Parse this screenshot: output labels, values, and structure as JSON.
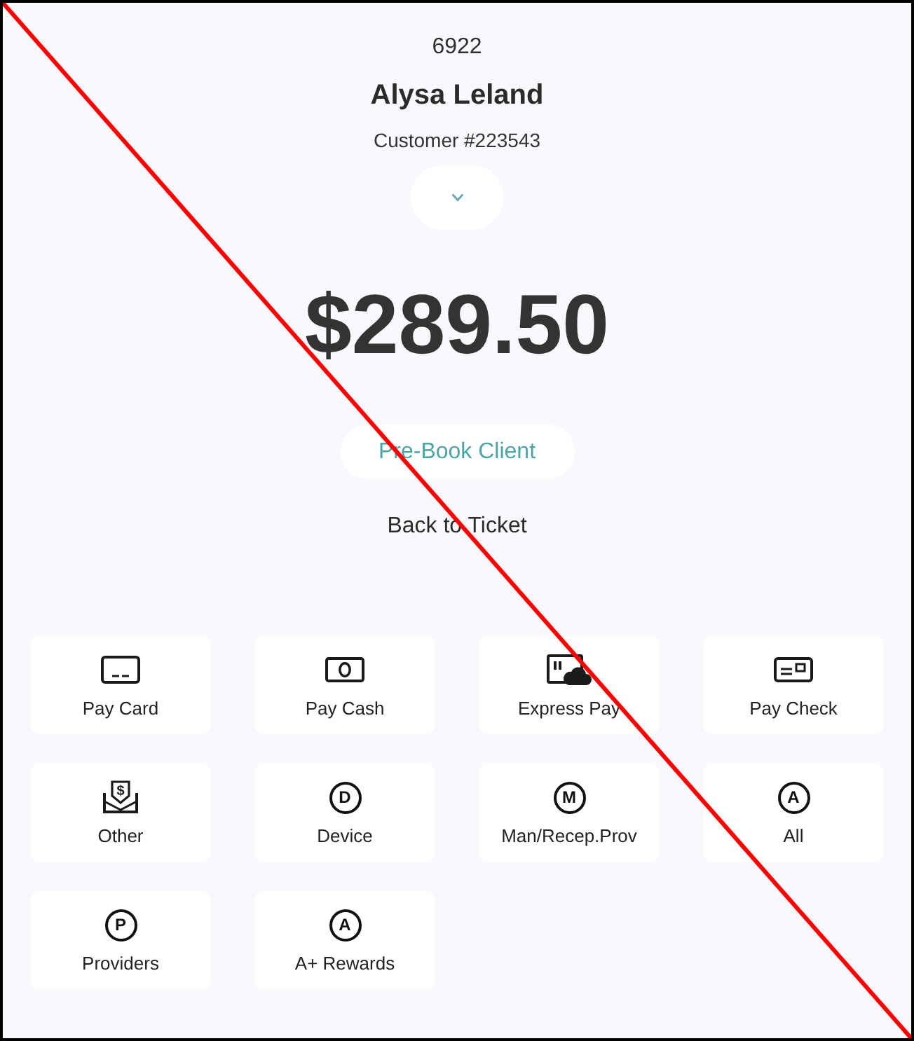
{
  "header": {
    "ticket_number": "6922",
    "customer_name": "Alysa Leland",
    "customer_id": "Customer #223543"
  },
  "amount": "$289.50",
  "prebook_button": {
    "label": "Pre-Book Client"
  },
  "back_link": {
    "label": "Back to Ticket"
  },
  "payment_options": [
    {
      "kind": "card",
      "label": "Pay Card"
    },
    {
      "kind": "cash",
      "label": "Pay Cash"
    },
    {
      "kind": "express",
      "label": "Express Pay"
    },
    {
      "kind": "check",
      "label": "Pay Check"
    },
    {
      "kind": "other",
      "glyph": "$",
      "label": "Other"
    },
    {
      "kind": "letter",
      "glyph": "D",
      "label": "Device"
    },
    {
      "kind": "letter",
      "glyph": "M",
      "label": "Man/Recep.Prov"
    },
    {
      "kind": "letter",
      "glyph": "A",
      "label": "All"
    },
    {
      "kind": "letter",
      "glyph": "P",
      "label": "Providers"
    },
    {
      "kind": "letter",
      "glyph": "A",
      "label": "A+ Rewards"
    }
  ],
  "crossed_out": true
}
